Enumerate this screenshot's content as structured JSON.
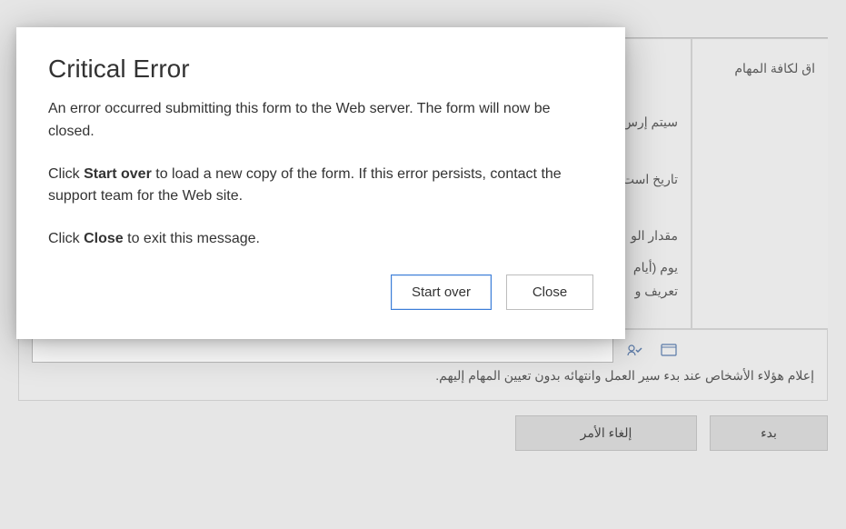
{
  "modal": {
    "title": "Critical Error",
    "para1": "An error occurred submitting this form to the Web server. The form will now be closed.",
    "para2_pre": "Click ",
    "para2_bold": "Start over",
    "para2_post": " to load a new copy of the form. If this error persists, contact the support team for the Web site.",
    "para3_pre": "Click ",
    "para3_bold": "Close",
    "para3_post": " to exit this message.",
    "startOverLabel": "Start over",
    "closeLabel": "Close"
  },
  "form": {
    "rightColLabel": "اق لكافة المهام",
    "labels": {
      "sendTo": "سيتم إرس",
      "dueDate": "تاريخ است",
      "duration": "مقدار الو",
      "daysLine": "يوم (أيام",
      "definition": "تعريف و"
    },
    "peopleCaption": "إعلام هؤلاء الأشخاص عند بدء سير العمل وانتهائه بدون تعيين المهام إليهم.",
    "buttons": {
      "cancel": "إلغاء الأمر",
      "start": "بدء"
    }
  }
}
